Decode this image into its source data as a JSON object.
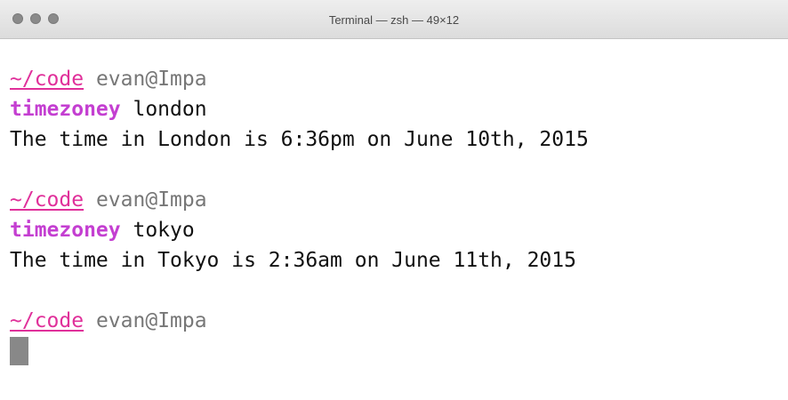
{
  "window": {
    "title": "Terminal — zsh — 49×12",
    "traffic_lights": [
      "close",
      "minimize",
      "zoom"
    ]
  },
  "colors": {
    "path": "#e0309a",
    "userhost": "#777777",
    "command": "#c43fd1",
    "text": "#111111",
    "cursor": "#888888"
  },
  "session": [
    {
      "prompt_path": "~/code",
      "prompt_userhost": "evan@Impa",
      "command": "timezoney",
      "argument": "london",
      "output": "The time in London is 6:36pm on June 10th, 2015"
    },
    {
      "prompt_path": "~/code",
      "prompt_userhost": "evan@Impa",
      "command": "timezoney",
      "argument": "tokyo",
      "output": "The time in Tokyo is 2:36am on June 11th, 2015"
    }
  ],
  "current_prompt": {
    "prompt_path": "~/code",
    "prompt_userhost": "evan@Impa"
  }
}
